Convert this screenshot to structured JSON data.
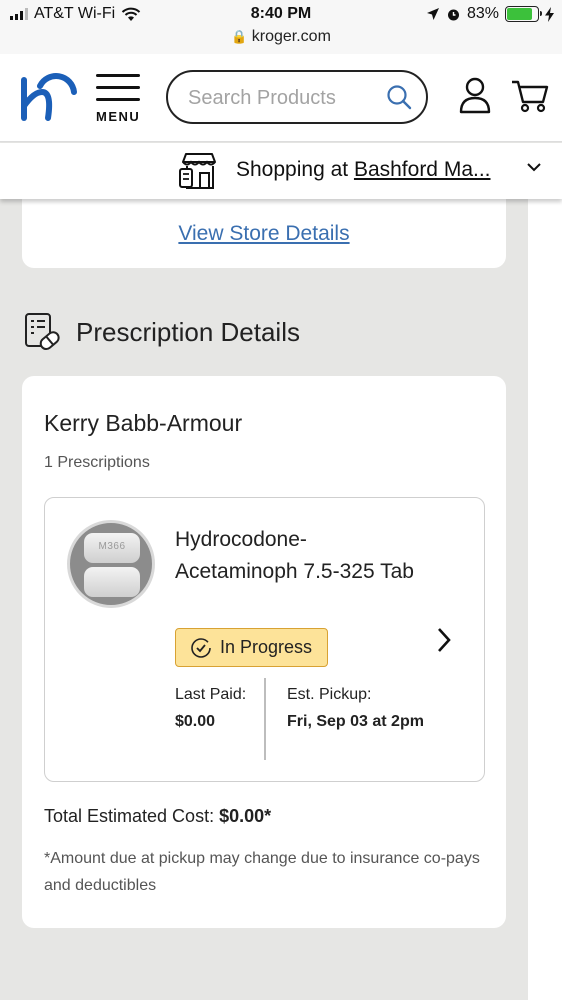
{
  "status_bar": {
    "carrier": "AT&T Wi-Fi",
    "time": "8:40 PM",
    "url": "kroger.com",
    "battery": "83%",
    "battery_level": 0.83
  },
  "header": {
    "menu_label": "MENU",
    "search_placeholder": "Search Products"
  },
  "shopping_bar": {
    "prefix": "Shopping at ",
    "store": "Bashford Ma..."
  },
  "store_card": {
    "link": "View Store Details"
  },
  "prescription": {
    "section_title": "Prescription Details",
    "patient_name": "Kerry Babb-Armour",
    "count": "1 Prescriptions",
    "item": {
      "pill_imprint": "M366",
      "drug_name": "Hydrocodone-Acetaminoph 7.5-325 Tab",
      "status": "In Progress",
      "last_paid_label": "Last Paid:",
      "last_paid_value": "$0.00",
      "pickup_label": "Est. Pickup:",
      "pickup_value": "Fri, Sep 03 at 2pm"
    },
    "total_label": "Total Estimated Cost: ",
    "total_value": "$0.00*",
    "note": "*Amount due at pickup may change due to insurance co-pays and deductibles"
  },
  "colors": {
    "brand_blue": "#1b5fb8",
    "link_blue": "#3a6fb0",
    "badge_bg": "#fde399",
    "badge_border": "#d8a233",
    "battery_green": "#3cc13b"
  }
}
